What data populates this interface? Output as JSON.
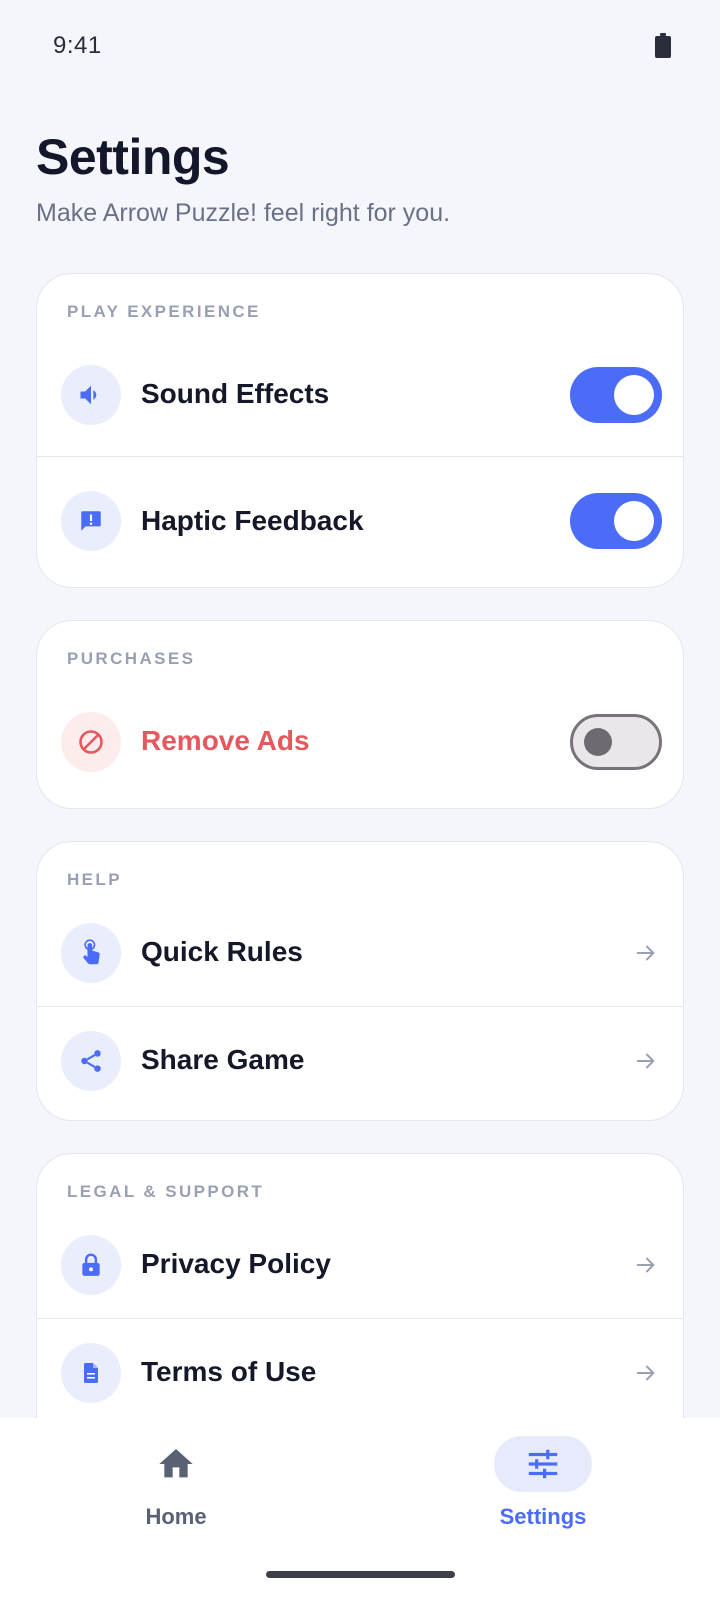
{
  "status_bar": {
    "time": "9:41"
  },
  "header": {
    "title": "Settings",
    "subtitle": "Make Arrow Puzzle! feel right for you."
  },
  "sections": {
    "play": {
      "label": "PLAY EXPERIENCE",
      "items": [
        {
          "label": "Sound Effects",
          "icon": "speaker-icon",
          "toggle": true
        },
        {
          "label": "Haptic Feedback",
          "icon": "feedback-icon",
          "toggle": true
        }
      ]
    },
    "purchases": {
      "label": "PURCHASES",
      "items": [
        {
          "label": "Remove Ads",
          "icon": "block-icon",
          "toggle": false
        }
      ]
    },
    "help": {
      "label": "HELP",
      "items": [
        {
          "label": "Quick Rules",
          "icon": "tap-icon"
        },
        {
          "label": "Share Game",
          "icon": "share-icon"
        }
      ]
    },
    "legal": {
      "label": "LEGAL & SUPPORT",
      "items": [
        {
          "label": "Privacy Policy",
          "icon": "lock-icon"
        },
        {
          "label": "Terms of Use",
          "icon": "document-icon"
        }
      ]
    }
  },
  "bottom_nav": {
    "items": [
      {
        "label": "Home",
        "icon": "home-icon",
        "active": false
      },
      {
        "label": "Settings",
        "icon": "sliders-icon",
        "active": true
      }
    ]
  },
  "colors": {
    "accent": "#4a6cf7",
    "danger": "#e5585d",
    "background": "#f5f6fb",
    "card": "#ffffff",
    "toggle_off_track": "#ebe6ea",
    "toggle_off_knob": "#6f6a72"
  }
}
